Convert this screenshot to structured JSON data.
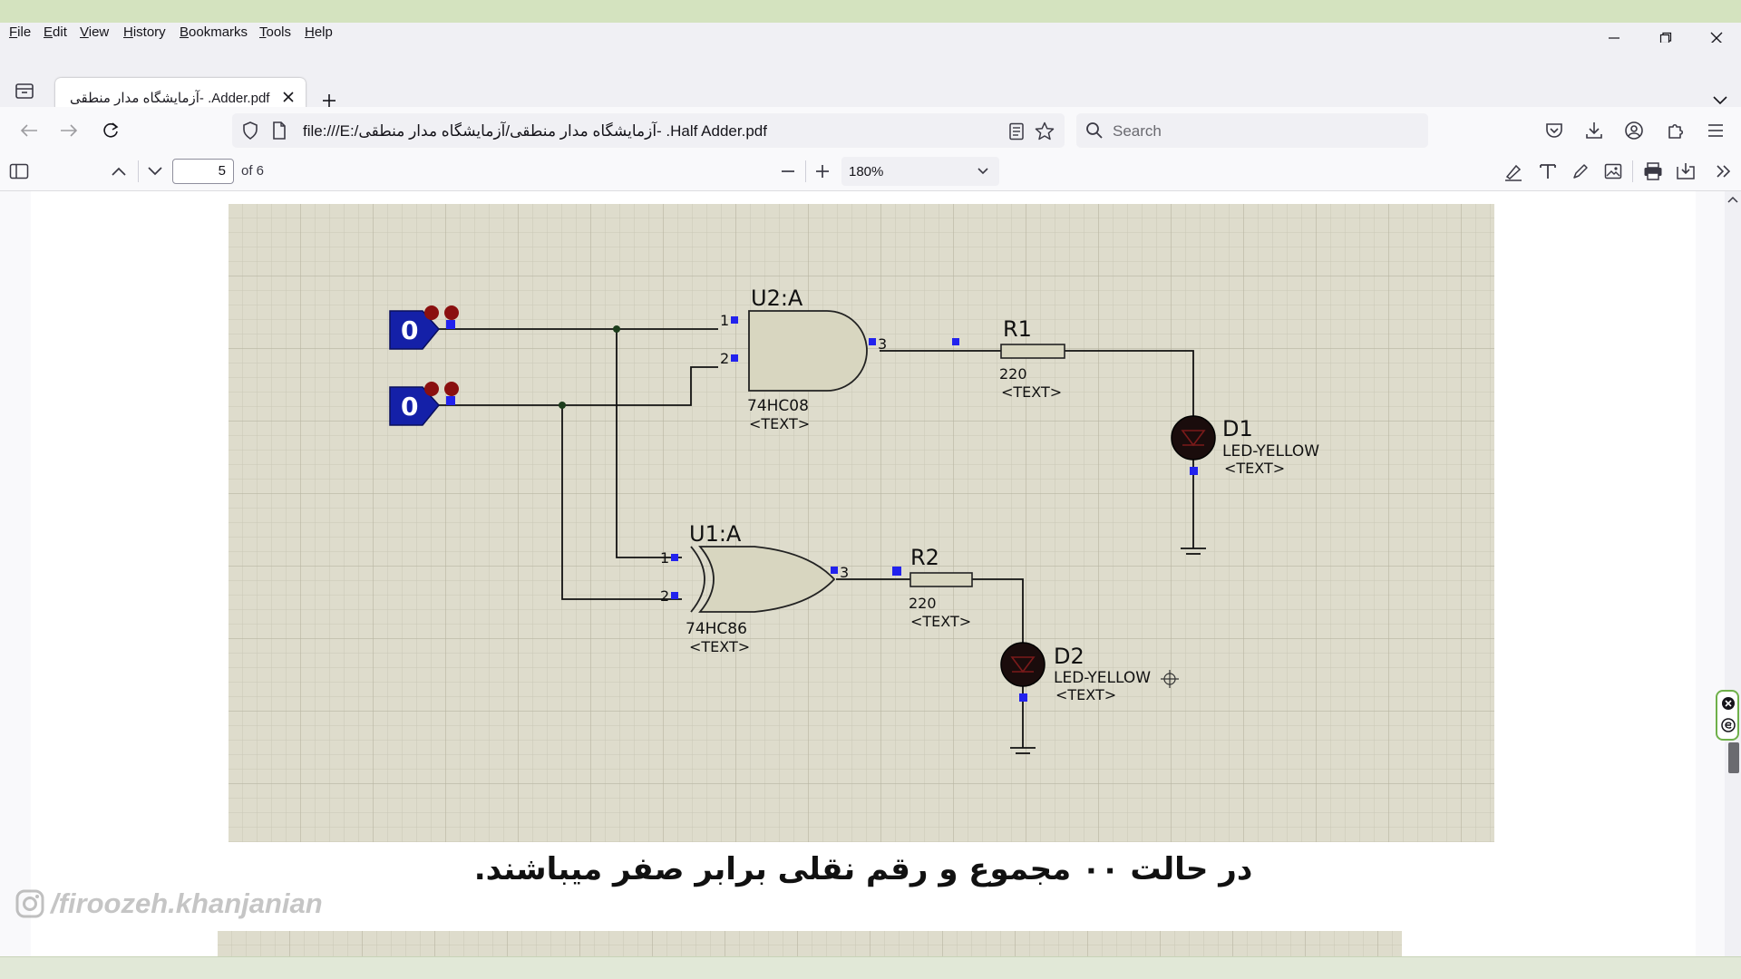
{
  "menu": [
    "File",
    "Edit",
    "View",
    "History",
    "Bookmarks",
    "Tools",
    "Help"
  ],
  "tab": {
    "title": "آزمایشگاه مدار منطقی- .Adder.pdf"
  },
  "nav": {
    "url": "file:///E:/آزمایشگاه مدار منطقی/آزمایشگاه مدار منطقی- .Half Adder.pdf",
    "search_placeholder": "Search"
  },
  "pdf": {
    "page": "5",
    "page_of": "of 6",
    "zoom": "180%"
  },
  "schematic": {
    "inputs": [
      "0",
      "0"
    ],
    "and_gate": {
      "name": "U2:A",
      "part": "74HC08",
      "text": "<TEXT>",
      "pins": [
        "1",
        "2",
        "3"
      ]
    },
    "xor_gate": {
      "name": "U1:A",
      "part": "74HC86",
      "text": "<TEXT>",
      "pins": [
        "1",
        "2",
        "3"
      ]
    },
    "r1": {
      "name": "R1",
      "value": "220",
      "text": "<TEXT>"
    },
    "r2": {
      "name": "R2",
      "value": "220",
      "text": "<TEXT>"
    },
    "d1": {
      "name": "D1",
      "part": "LED-YELLOW",
      "text": "<TEXT>"
    },
    "d2": {
      "name": "D2",
      "part": "LED-YELLOW",
      "text": "<TEXT>"
    }
  },
  "caption": "در حالت ۰۰ مجموع و رقم نقلی برابر صفر میباشند.",
  "watermark": "/firoozeh.khanjanian",
  "colors": {
    "grid_bg": "#dedccc",
    "grid_line": "#c9c7b6",
    "gate_fill": "#d8d6c0",
    "input_blue": "#1420a8",
    "pin_blue": "#2222ee",
    "led": "#1a0c0c",
    "accent_green": "#6fb04a"
  }
}
